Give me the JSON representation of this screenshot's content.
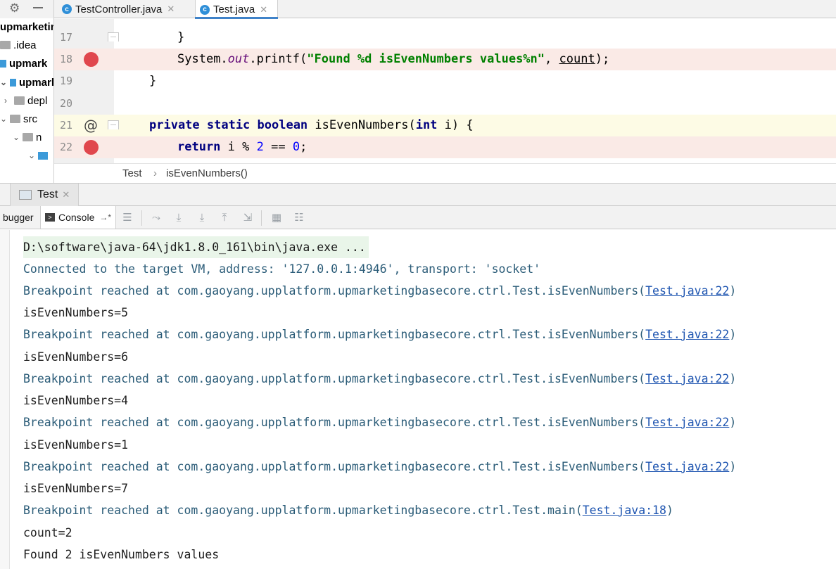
{
  "top_tabs": [
    {
      "label": "TestController.java",
      "icon": "c"
    },
    {
      "label": "Test.java",
      "icon": "c"
    }
  ],
  "project_tree": {
    "items": [
      {
        "label": "upmarketin",
        "bold": true
      },
      {
        "label": ".idea",
        "bold": false
      },
      {
        "label": "upmark",
        "bold": true
      },
      {
        "label": "upmark",
        "bold": true
      },
      {
        "label": "depl",
        "bold": false
      },
      {
        "label": "src",
        "bold": false
      },
      {
        "label": "n",
        "bold": false
      }
    ]
  },
  "editor": {
    "lines": [
      {
        "no": "17",
        "text": "}"
      },
      {
        "no": "18",
        "prefix": "System.",
        "field": "out",
        "mid": ".printf(",
        "str": "\"Found %d isEvenNumbers values%n\"",
        "sep": ", ",
        "var": "count",
        "end": ");"
      },
      {
        "no": "19",
        "text": "}"
      },
      {
        "no": "20",
        "text": ""
      },
      {
        "no": "21",
        "k1": "private static boolean",
        "name": " isEvenNumbers(",
        "k2": "int",
        "rest": " i) {"
      },
      {
        "no": "22",
        "k1": "return",
        "a": " i % ",
        "n1": "2",
        "b": " == ",
        "n2": "0",
        "c": ";"
      }
    ],
    "gutter_marks": {
      "bp_lines": [
        "18",
        "22"
      ],
      "override_line": "21",
      "at_symbol": "@"
    }
  },
  "breadcrumbs": {
    "file": "Test",
    "sep": "›",
    "method": "isEvenNumbers()"
  },
  "run_tab": {
    "label": "Test"
  },
  "debug_toolbar": {
    "debugger_label": "bugger",
    "console_label": "Console",
    "pin": "→*"
  },
  "console": {
    "command": "D:\\software\\java-64\\jdk1.8.0_161\\bin\\java.exe ...",
    "connected": "Connected to the target VM, address: '127.0.0.1:4946', transport: 'socket'",
    "bp_prefix": "Breakpoint reached at com.gaoyang.upplatform.upmarketingbasecore.ctrl.Test.isEvenNumbers(",
    "bp_link": "Test.java:22",
    "bp_suffix": ")",
    "outputs": [
      "isEvenNumbers=5",
      "isEvenNumbers=6",
      "isEvenNumbers=4",
      "isEvenNumbers=1",
      "isEvenNumbers=7"
    ],
    "main_prefix": "Breakpoint reached at com.gaoyang.upplatform.upmarketingbasecore.ctrl.Test.main(",
    "main_link": "Test.java:18",
    "main_suffix": ")",
    "count_line": "count=2",
    "final_line": "Found 2 isEvenNumbers values"
  },
  "colors": {
    "breakpoint": "#e0474d",
    "keyword": "#000080",
    "string": "#008000",
    "link": "#1d54b0",
    "active_tab_underline": "#4083c9"
  }
}
